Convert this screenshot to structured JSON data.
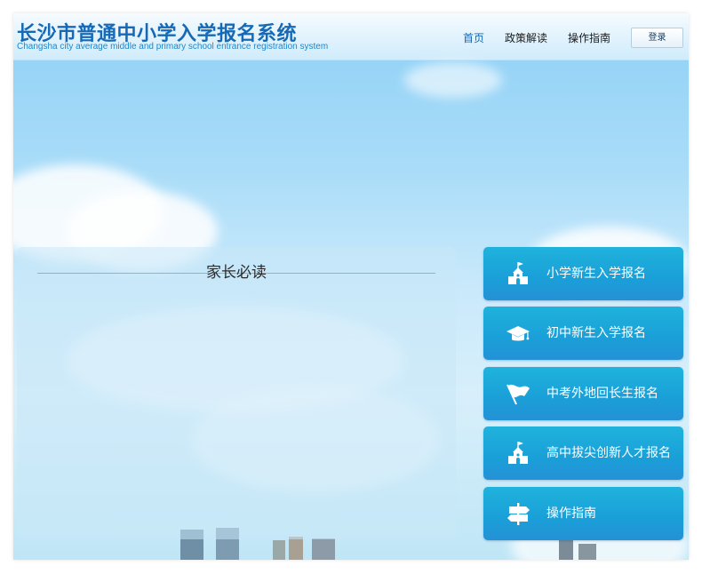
{
  "header": {
    "title": "长沙市普通中小学入学报名系统",
    "subtitle": "Changsha city average middle and primary school entrance registration system",
    "nav": [
      {
        "label": "首页",
        "active": true
      },
      {
        "label": "政策解读",
        "active": false
      },
      {
        "label": "操作指南",
        "active": false
      }
    ],
    "login_label": "登录"
  },
  "notice": {
    "title": "家长必读"
  },
  "entries": [
    {
      "label": "小学新生入学报名",
      "icon": "school-building-icon"
    },
    {
      "label": "初中新生入学报名",
      "icon": "graduation-cap-icon"
    },
    {
      "label": "中考外地回长生报名",
      "icon": "flag-icon"
    },
    {
      "label": "高中拔尖创新人才报名",
      "icon": "school-building-icon"
    },
    {
      "label": "操作指南",
      "icon": "signpost-icon"
    }
  ],
  "colors": {
    "brand": "#1569b6",
    "card": "#1aa3d9",
    "sky": "#a9dcf8"
  }
}
